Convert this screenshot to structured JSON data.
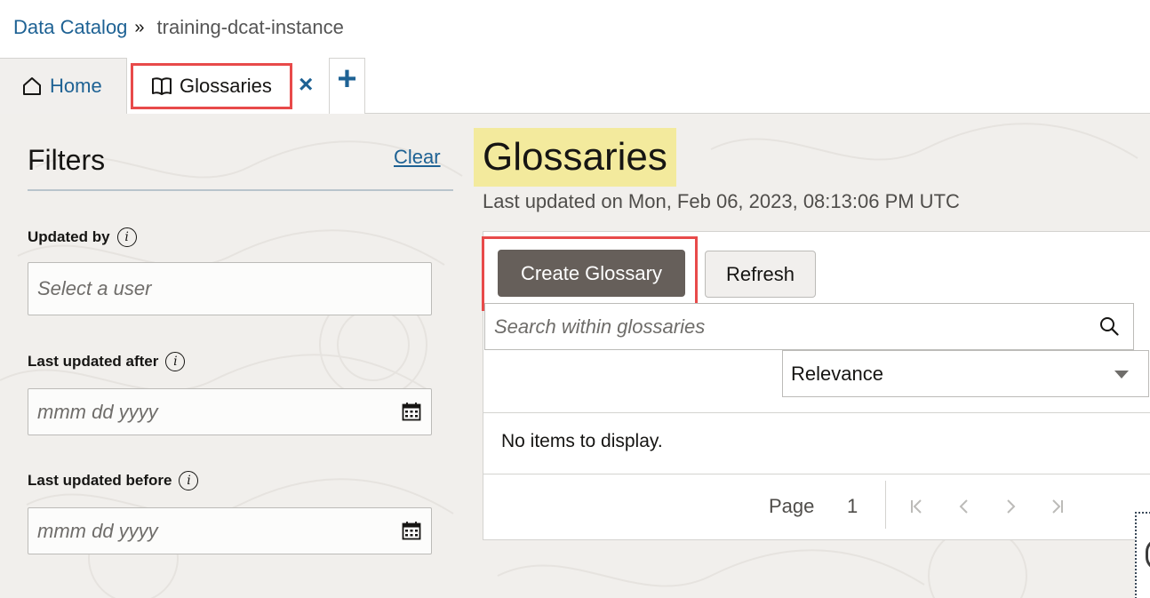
{
  "breadcrumb": {
    "root": "Data Catalog",
    "separator": "»",
    "current": "training-dcat-instance"
  },
  "tabs": {
    "home_label": "Home",
    "glossaries_label": "Glossaries",
    "close_symbol": "×",
    "add_symbol": "+"
  },
  "filters": {
    "title": "Filters",
    "clear_label": "Clear",
    "updated_by": {
      "label": "Updated by",
      "placeholder": "Select a user"
    },
    "last_updated_after": {
      "label": "Last updated after",
      "placeholder": "mmm dd yyyy"
    },
    "last_updated_before": {
      "label": "Last updated before",
      "placeholder": "mmm dd yyyy"
    }
  },
  "main": {
    "title": "Glossaries",
    "last_updated": "Last updated on Mon, Feb 06, 2023, 08:13:06 PM UTC",
    "create_button": "Create Glossary",
    "refresh_button": "Refresh",
    "search_placeholder": "Search within glossaries",
    "sort_value": "Relevance",
    "empty_message": "No items to display.",
    "pagination": {
      "page_label": "Page",
      "page_number": "1"
    }
  },
  "colors": {
    "link": "#1e6294",
    "highlight_box": "#e84a4a",
    "title_highlight": "#f3ea9d",
    "primary_button": "#665f5a"
  }
}
